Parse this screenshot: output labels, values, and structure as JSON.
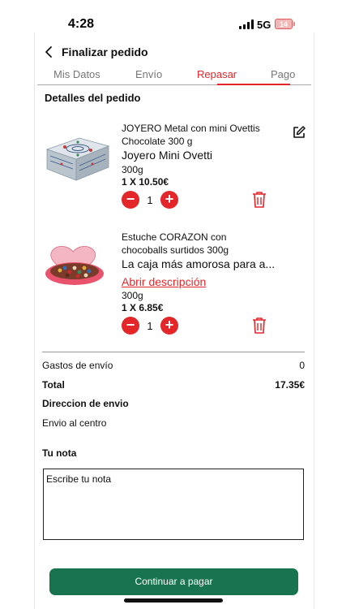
{
  "status_bar": {
    "time": "4:28",
    "network": "5G",
    "battery": "14"
  },
  "header": {
    "title": "Finalizar pedido"
  },
  "tabs": [
    {
      "label": "Mis Datos"
    },
    {
      "label": "Envío"
    },
    {
      "label": "Repasar"
    },
    {
      "label": "Pago"
    }
  ],
  "active_tab": "Repasar",
  "section_title": "Detalles del pedido",
  "products": [
    {
      "name": "JOYERO Metal con mini Ovettis Chocolate 300 g",
      "subtitle": "Joyero Mini Ovetti",
      "weight": "300g",
      "price": "1 X 10.50€",
      "qty": "1"
    },
    {
      "name": "Estuche CORAZON con chocoballs surtidos 300g",
      "subtitle": "La caja más amorosa para a...",
      "link": "Abrir descripción",
      "weight": "300g",
      "price": "1 X 6.85€",
      "qty": "1"
    }
  ],
  "summary": {
    "shipping_label": "Gastos de envío",
    "shipping_value": "0",
    "total_label": "Total",
    "total_value": "17.35€",
    "address_label": "Direccion de envio",
    "address_value": "Envio al centro"
  },
  "note": {
    "label": "Tu nota",
    "placeholder": "Escribe tu nota"
  },
  "cta": {
    "label": "Continuar a pagar"
  },
  "colors": {
    "accent": "#e3262a",
    "primary": "#17744f"
  }
}
